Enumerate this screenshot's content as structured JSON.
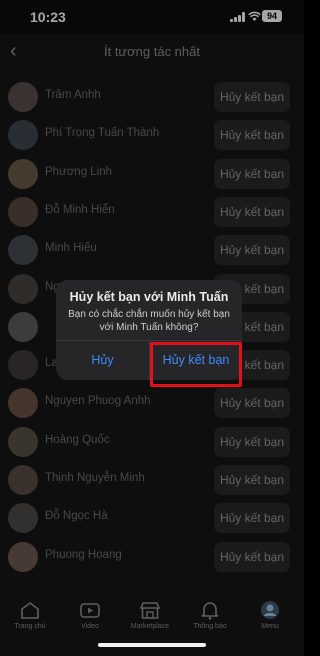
{
  "status_bar": {
    "time": "10:23",
    "battery": "94"
  },
  "header": {
    "title": "Ít tương tác nhất"
  },
  "friends": [
    {
      "name": "Trâm Anhh",
      "button": "Hủy kết bạn",
      "avatar_color": "#5a4e4a"
    },
    {
      "name": "Phí Trọng Tuấn Thành",
      "button": "Hủy kết bạn",
      "avatar_color": "#3f4550"
    },
    {
      "name": "Phương Linh",
      "button": "Hủy kết bạn",
      "avatar_color": "#6a5a48"
    },
    {
      "name": "Đỗ Minh Hiển",
      "button": "Hủy kết bạn",
      "avatar_color": "#584840"
    },
    {
      "name": "Minh Hiếu",
      "button": "Hủy kết bạn",
      "avatar_color": "#454a52"
    },
    {
      "name": "Ng",
      "button": "Hủy kết bạn",
      "avatar_color": "#4a4440"
    },
    {
      "name": "",
      "button": "Hủy kết bạn",
      "avatar_color": "#5c5c5e"
    },
    {
      "name": "La",
      "button": "Hủy kết bạn",
      "avatar_color": "#3e3a38"
    },
    {
      "name": "Nguyen Phuog Anhh",
      "button": "Hủy kết bạn",
      "avatar_color": "#6a5246"
    },
    {
      "name": "Hoàng Quốc",
      "button": "Hủy kết bạn",
      "avatar_color": "#5a5048"
    },
    {
      "name": "Thịnh Nguyễn Minh",
      "button": "Hủy kết bạn",
      "avatar_color": "#5a4a44"
    },
    {
      "name": "Đỗ Ngọc Hà",
      "button": "Hủy kết bạn",
      "avatar_color": "#4e4a48"
    },
    {
      "name": "Phuong Hoang",
      "button": "Hủy kết bạn",
      "avatar_color": "#6e5a50"
    }
  ],
  "dialog": {
    "title": "Hủy kết bạn với Minh Tuấn",
    "message": "Bạn có chắc chắn muốn hủy kết bạn với Minh Tuấn không?",
    "cancel": "Hủy",
    "confirm": "Hủy kết bạn"
  },
  "tabs": [
    {
      "label": "Trang chủ",
      "icon": "home-icon"
    },
    {
      "label": "Video",
      "icon": "video-icon"
    },
    {
      "label": "Marketplace",
      "icon": "marketplace-icon"
    },
    {
      "label": "Thông báo",
      "icon": "bell-icon"
    },
    {
      "label": "Menu",
      "icon": "profile-icon"
    }
  ],
  "colors": {
    "accent": "#3c8dff",
    "highlight": "#e3101b"
  }
}
